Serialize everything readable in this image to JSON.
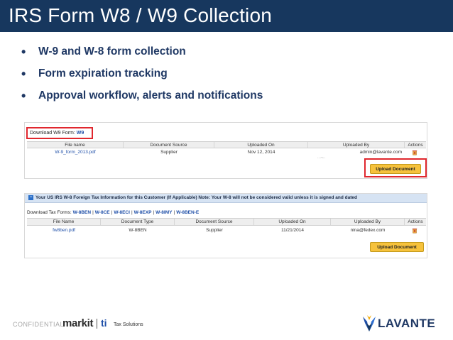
{
  "title": "IRS Form W8 / W9 Collection",
  "bullets": [
    "W-9 and W-8 form collection",
    "Form expiration tracking",
    "Approval workflow, alerts and notifications"
  ],
  "panel_w9": {
    "download_label": "Download W9 Form:",
    "download_link": "W9",
    "columns": [
      "File name",
      "Document Source",
      "Uploaded On",
      "Uploaded By",
      "Actions"
    ],
    "row": {
      "file_name": "W-9_form_2013.pdf",
      "document_source": "Supplier",
      "uploaded_on": "Nov 12, 2014",
      "uploaded_by": "admin@lavante.com"
    },
    "upload_button": "Upload Document"
  },
  "panel_w8": {
    "header": "Your US IRS W-8 Foreign Tax Information for this Customer (If Applicable) Note: Your W-8 will not be considered valid unless it is signed and dated",
    "download_label": "Download Tax Forms:",
    "tax_forms": [
      "W-8BEN",
      "W-8CE",
      "W-8ECI",
      "W-8EXP",
      "W-8IMY",
      "W-8BEN-E"
    ],
    "columns": [
      "File Name",
      "Document Type",
      "Document Source",
      "Uploaded On",
      "Uploaded By",
      "Actions"
    ],
    "row": {
      "file_name": "fw8ben.pdf",
      "document_type": "W-8BEN",
      "document_source": "Supplier",
      "uploaded_on": "11/21/2014",
      "uploaded_by": "nina@fedex.com"
    },
    "upload_button": "Upload Document"
  },
  "footer": {
    "confidential": "CONFIDENTIAL",
    "markit": "markit",
    "ti": "ti",
    "tax_solutions": "Tax Solutions",
    "lavante": "LAVANTE"
  },
  "colors": {
    "title_bar": "#17375e",
    "bullet_text": "#1f3864",
    "highlight_border": "#e0272e",
    "upload_button": "#f6c23c",
    "link": "#1f4fa8"
  }
}
